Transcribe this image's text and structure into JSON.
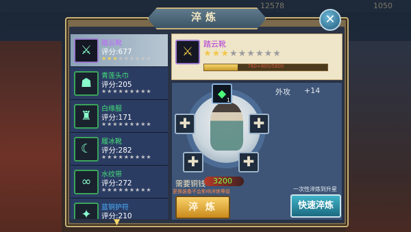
{
  "window": {
    "title": "淬炼",
    "close_label": "✕"
  },
  "background": {
    "top_ghost_1": "12578",
    "top_ghost_2": "1050"
  },
  "equipment_list": [
    {
      "name": "踏云靴",
      "score": "评分:677",
      "stars_on": 3,
      "stars_total": 9,
      "selected": true,
      "icon": "boots-icon",
      "glyph": "⚔"
    },
    {
      "name": "青莲头巾",
      "score": "评分:205",
      "stars_on": 0,
      "stars_total": 9,
      "selected": false,
      "icon": "headband-icon",
      "glyph": "☗"
    },
    {
      "name": "白缘服",
      "score": "评分:171",
      "stars_on": 0,
      "stars_total": 9,
      "selected": false,
      "icon": "robe-icon",
      "glyph": "♜"
    },
    {
      "name": "履冰靴",
      "score": "评分:282",
      "stars_on": 0,
      "stars_total": 9,
      "selected": false,
      "icon": "ice-boots-icon",
      "glyph": "☾"
    },
    {
      "name": "水纹带",
      "score": "评分:272",
      "stars_on": 0,
      "stars_total": 9,
      "selected": false,
      "icon": "belt-icon",
      "glyph": "∞"
    },
    {
      "name": "蓝铜护符",
      "score": "评分:210",
      "stars_on": 0,
      "stars_total": 9,
      "selected": false,
      "icon": "amulet-icon",
      "glyph": "✦"
    }
  ],
  "selected_item": {
    "name": "踏云靴",
    "stars_on": 3,
    "stars_total": 9,
    "progress_text": "760+800/5800",
    "progress_fraction": 0.27
  },
  "stat": {
    "label": "外攻",
    "value": "+14"
  },
  "gem": {
    "count": "1"
  },
  "cost": {
    "label": "需要铜钱",
    "value": "3200"
  },
  "note": "更换装备不会影响淬炼等级",
  "quick_note": "一次性淬炼到升星",
  "buttons": {
    "forge": "淬 炼",
    "quick": "快速淬炼"
  },
  "colors": {
    "accent_gold": "#c9b37a",
    "selected_purple": "#c066ff",
    "green_name": "#44e07a",
    "cost_green": "#7cff4a"
  }
}
